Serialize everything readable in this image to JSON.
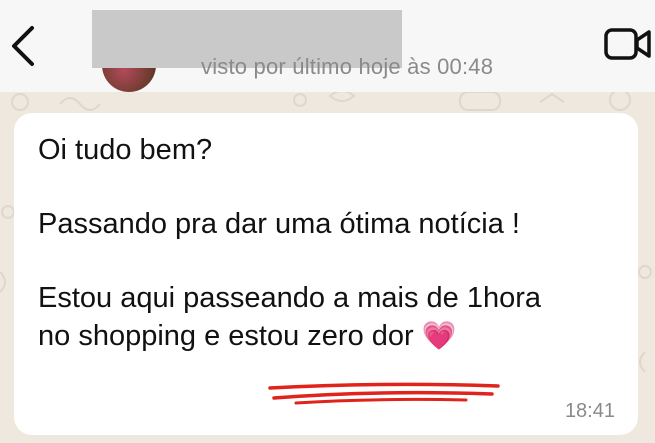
{
  "chat_header": {
    "last_seen": "visto por último hoje às 00:48"
  },
  "message": {
    "line1": "Oi tudo bem?",
    "line2": "Passando pra dar uma ótima notícia !",
    "line3": "Estou aqui passeando a mais de 1hora",
    "line4_prefix": "no shopping e ",
    "line4_highlight": "estou zero dor",
    "emoji": "💗",
    "time": "18:41"
  },
  "colors": {
    "wallpaper": "#efe8de",
    "bubble": "#ffffff",
    "underline_annotation": "#e0241b"
  },
  "icons": [
    "back-chevron-icon",
    "video-call-icon"
  ]
}
